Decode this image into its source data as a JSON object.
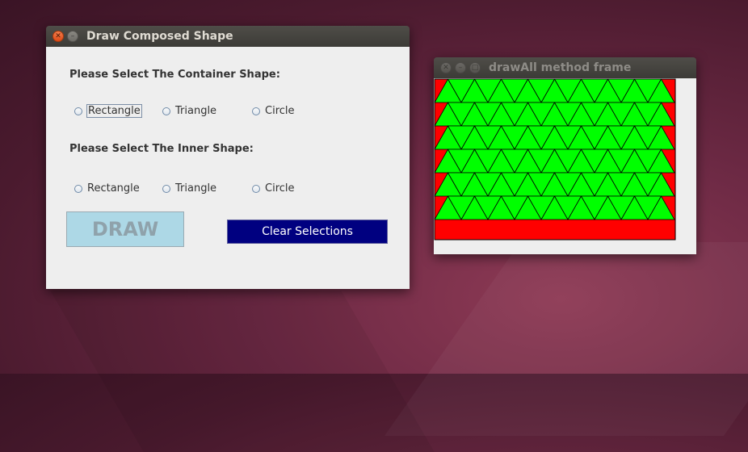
{
  "window1": {
    "title": "Draw Composed Shape",
    "container_label": "Please Select The Container Shape:",
    "container_options": [
      "Rectangle",
      "Triangle",
      "Circle"
    ],
    "inner_label": "Please Select The Inner Shape:",
    "inner_options": [
      "Rectangle",
      "Triangle",
      "Circle"
    ],
    "draw_label": "DRAW",
    "clear_label": "Clear Selections"
  },
  "window2": {
    "title": "drawAll method frame"
  },
  "canvas": {
    "container_color": "#ff0000",
    "shape_color": "#00ff00",
    "rows": 6,
    "triangles_per_row": 9
  }
}
